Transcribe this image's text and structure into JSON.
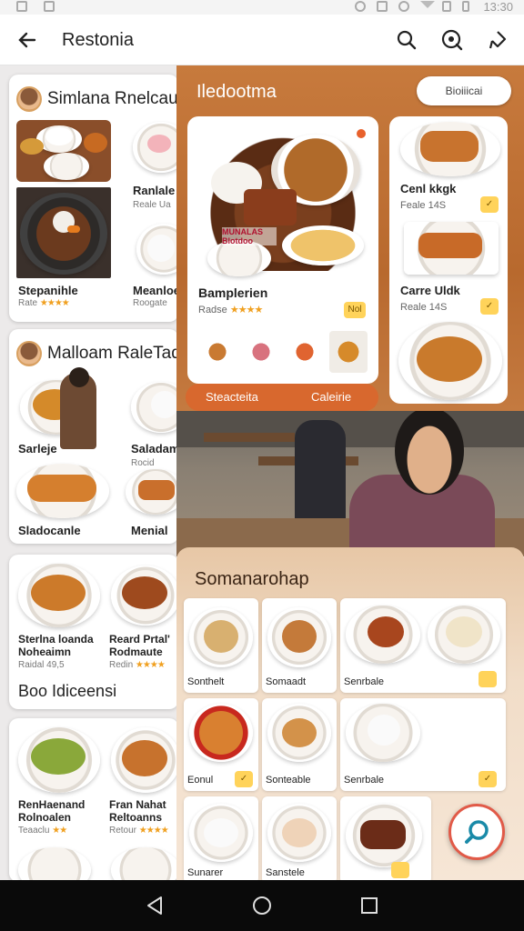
{
  "app": {
    "title": "Restonia"
  },
  "statusbar": {
    "time": "13:30"
  },
  "left_cards": [
    {
      "header": "Simlana Rnelcaul",
      "items": [
        {
          "name": "Stepanihle",
          "sub": "Rate",
          "stars": "★★★★"
        },
        {
          "name": "Ranlale",
          "sub": "Reale Ua",
          "stars": ""
        },
        {
          "name": "Meanloe",
          "sub": "Roogate",
          "stars": ""
        }
      ]
    },
    {
      "header": "Malloam RaleTadbt",
      "items": [
        {
          "name": "Sarleje",
          "sub": "",
          "stars": ""
        },
        {
          "name": "Saladam",
          "sub": "Rocid",
          "stars": ""
        },
        {
          "name": "Sladocanle",
          "sub": "",
          "stars": ""
        },
        {
          "name": "Menial",
          "sub": "",
          "stars": ""
        }
      ]
    },
    {
      "header": "",
      "items": [
        {
          "name": "Sterlna loanda Noheaimn",
          "sub": "Raidal 49,5",
          "stars": ""
        },
        {
          "name": "Reard Prtal' Rodmaute",
          "sub": "Redin",
          "stars": "★★★★"
        }
      ],
      "section_title": "Boo Idiceensi"
    },
    {
      "header": "",
      "items": [
        {
          "name": "RenHaenand Rolnoalen",
          "sub": "Teaaclu",
          "stars": "★★"
        },
        {
          "name": "Fran Nahat Reltoanns",
          "sub": "Retour",
          "stars": "★★★★"
        }
      ]
    }
  ],
  "featured": {
    "title": "Iledootma",
    "button": "Bioiiicai",
    "big_card": {
      "overlay": "MUNALAS Blotdoo",
      "name": "Bamplerien",
      "sub": "Radse",
      "stars": "★★★★",
      "tag": "Nol"
    },
    "side_items": [
      {
        "name": "Cenl kkgk",
        "sub": "Feale 14S"
      },
      {
        "name": "Carre Uldk",
        "sub": "Reale 14S"
      }
    ],
    "actions": [
      "Steacteita",
      "Caleirie"
    ]
  },
  "grid": {
    "title": "Somanarohap",
    "cells": [
      {
        "label": "Sonthelt"
      },
      {
        "label": "Somaadt"
      },
      {
        "label": "Senrbale"
      },
      {
        "label": ""
      },
      {
        "label": "Eonul"
      },
      {
        "label": "Sonteable"
      },
      {
        "label": "Senrbale"
      },
      {
        "label": "Sunarer"
      },
      {
        "label": "Sanstele"
      },
      {
        "label": ""
      }
    ]
  },
  "colors": {
    "accent": "#d8682e",
    "panel": "#c07236",
    "fab_ring": "#e15a48",
    "fab_icon": "#1a8aa8"
  },
  "icons": [
    "back-arrow-icon",
    "search-icon",
    "search-alt-icon",
    "share-icon",
    "search-fab-icon",
    "nav-back-icon",
    "nav-home-icon",
    "nav-recents-icon"
  ]
}
